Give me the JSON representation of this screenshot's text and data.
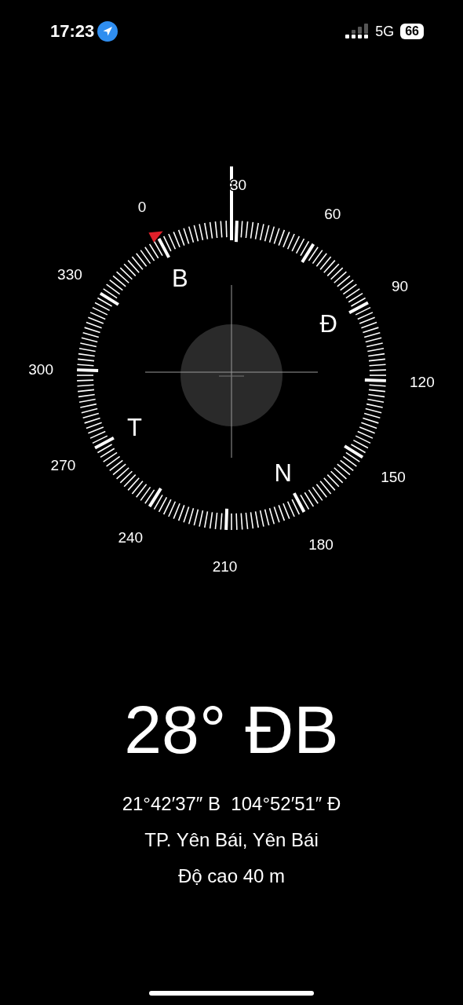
{
  "status_bar": {
    "time": "17:23",
    "network": "5G",
    "battery": "66"
  },
  "compass": {
    "degree_labels": [
      "0",
      "30",
      "60",
      "90",
      "120",
      "150",
      "180",
      "210",
      "240",
      "270",
      "300",
      "330"
    ],
    "cardinal_labels": [
      "B",
      "Đ",
      "N",
      "T"
    ]
  },
  "heading": "28° ĐB",
  "coordinates": "21°42′37″ B  104°52′51″ Đ",
  "location": "TP. Yên Bái, Yên Bái",
  "altitude": "Độ cao 40 m"
}
